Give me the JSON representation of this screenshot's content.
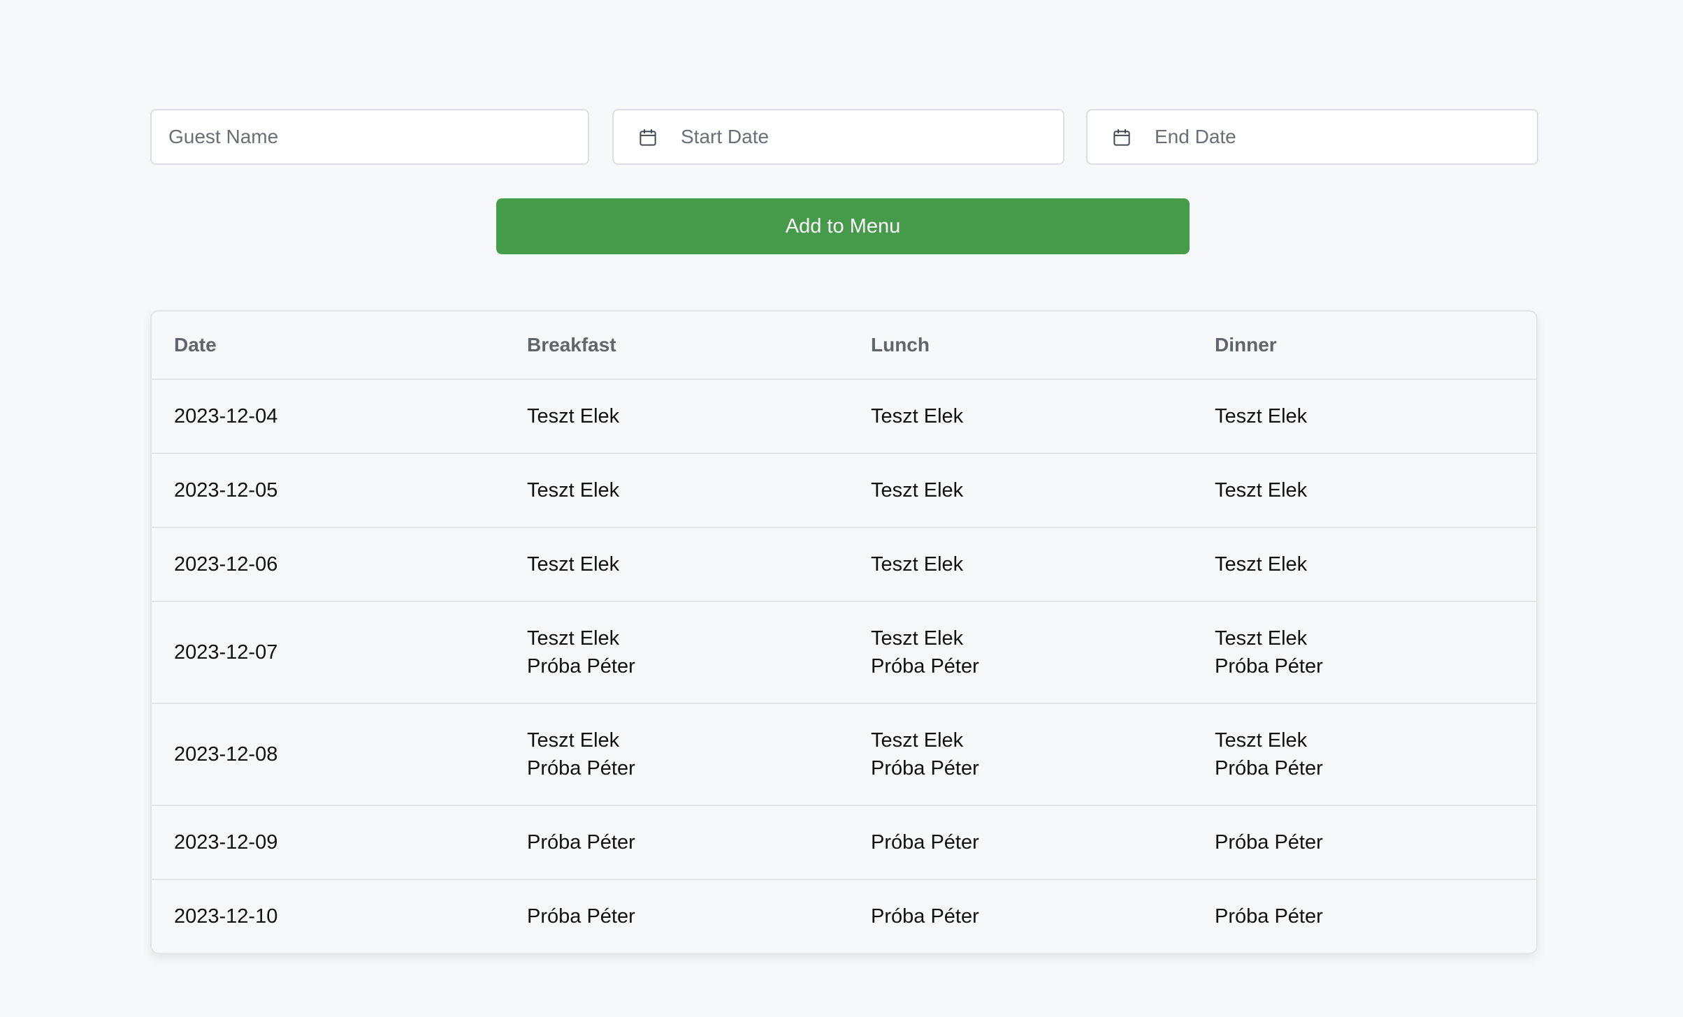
{
  "form": {
    "guest_name_placeholder": "Guest Name",
    "start_date_placeholder": "Start Date",
    "end_date_placeholder": "End Date",
    "start_date_icon": "calendar-icon",
    "end_date_icon": "calendar-icon"
  },
  "add_button": {
    "label": "Add to Menu",
    "color": "#469b4a"
  },
  "table": {
    "headers": [
      "Date",
      "Breakfast",
      "Lunch",
      "Dinner"
    ],
    "rows": [
      {
        "date": "2023-12-04",
        "breakfast": [
          "Teszt Elek"
        ],
        "lunch": [
          "Teszt Elek"
        ],
        "dinner": [
          "Teszt Elek"
        ]
      },
      {
        "date": "2023-12-05",
        "breakfast": [
          "Teszt Elek"
        ],
        "lunch": [
          "Teszt Elek"
        ],
        "dinner": [
          "Teszt Elek"
        ]
      },
      {
        "date": "2023-12-06",
        "breakfast": [
          "Teszt Elek"
        ],
        "lunch": [
          "Teszt Elek"
        ],
        "dinner": [
          "Teszt Elek"
        ]
      },
      {
        "date": "2023-12-07",
        "breakfast": [
          "Teszt Elek",
          "Próba Péter"
        ],
        "lunch": [
          "Teszt Elek",
          "Próba Péter"
        ],
        "dinner": [
          "Teszt Elek",
          "Próba Péter"
        ]
      },
      {
        "date": "2023-12-08",
        "breakfast": [
          "Teszt Elek",
          "Próba Péter"
        ],
        "lunch": [
          "Teszt Elek",
          "Próba Péter"
        ],
        "dinner": [
          "Teszt Elek",
          "Próba Péter"
        ]
      },
      {
        "date": "2023-12-09",
        "breakfast": [
          "Próba Péter"
        ],
        "lunch": [
          "Próba Péter"
        ],
        "dinner": [
          "Próba Péter"
        ]
      },
      {
        "date": "2023-12-10",
        "breakfast": [
          "Próba Péter"
        ],
        "lunch": [
          "Próba Péter"
        ],
        "dinner": [
          "Próba Péter"
        ]
      }
    ]
  }
}
